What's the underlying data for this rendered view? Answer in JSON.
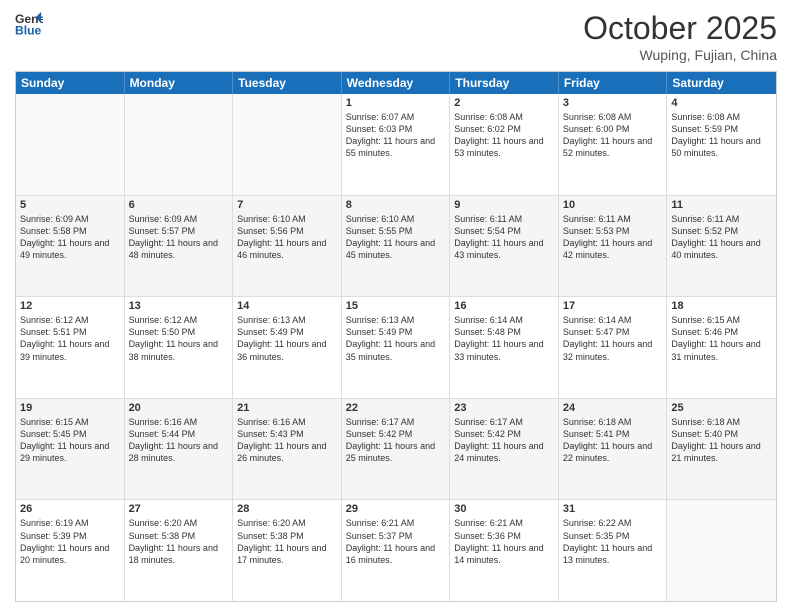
{
  "header": {
    "logo_line1": "General",
    "logo_line2": "Blue",
    "month_title": "October 2025",
    "location": "Wuping, Fujian, China"
  },
  "day_headers": [
    "Sunday",
    "Monday",
    "Tuesday",
    "Wednesday",
    "Thursday",
    "Friday",
    "Saturday"
  ],
  "weeks": [
    {
      "alt": false,
      "cells": [
        {
          "empty": true
        },
        {
          "empty": true
        },
        {
          "empty": true
        },
        {
          "day": 1,
          "sunrise": "6:07 AM",
          "sunset": "6:03 PM",
          "daylight": "11 hours and 55 minutes."
        },
        {
          "day": 2,
          "sunrise": "6:08 AM",
          "sunset": "6:02 PM",
          "daylight": "11 hours and 53 minutes."
        },
        {
          "day": 3,
          "sunrise": "6:08 AM",
          "sunset": "6:00 PM",
          "daylight": "11 hours and 52 minutes."
        },
        {
          "day": 4,
          "sunrise": "6:08 AM",
          "sunset": "5:59 PM",
          "daylight": "11 hours and 50 minutes."
        }
      ]
    },
    {
      "alt": true,
      "cells": [
        {
          "day": 5,
          "sunrise": "6:09 AM",
          "sunset": "5:58 PM",
          "daylight": "11 hours and 49 minutes."
        },
        {
          "day": 6,
          "sunrise": "6:09 AM",
          "sunset": "5:57 PM",
          "daylight": "11 hours and 48 minutes."
        },
        {
          "day": 7,
          "sunrise": "6:10 AM",
          "sunset": "5:56 PM",
          "daylight": "11 hours and 46 minutes."
        },
        {
          "day": 8,
          "sunrise": "6:10 AM",
          "sunset": "5:55 PM",
          "daylight": "11 hours and 45 minutes."
        },
        {
          "day": 9,
          "sunrise": "6:11 AM",
          "sunset": "5:54 PM",
          "daylight": "11 hours and 43 minutes."
        },
        {
          "day": 10,
          "sunrise": "6:11 AM",
          "sunset": "5:53 PM",
          "daylight": "11 hours and 42 minutes."
        },
        {
          "day": 11,
          "sunrise": "6:11 AM",
          "sunset": "5:52 PM",
          "daylight": "11 hours and 40 minutes."
        }
      ]
    },
    {
      "alt": false,
      "cells": [
        {
          "day": 12,
          "sunrise": "6:12 AM",
          "sunset": "5:51 PM",
          "daylight": "11 hours and 39 minutes."
        },
        {
          "day": 13,
          "sunrise": "6:12 AM",
          "sunset": "5:50 PM",
          "daylight": "11 hours and 38 minutes."
        },
        {
          "day": 14,
          "sunrise": "6:13 AM",
          "sunset": "5:49 PM",
          "daylight": "11 hours and 36 minutes."
        },
        {
          "day": 15,
          "sunrise": "6:13 AM",
          "sunset": "5:49 PM",
          "daylight": "11 hours and 35 minutes."
        },
        {
          "day": 16,
          "sunrise": "6:14 AM",
          "sunset": "5:48 PM",
          "daylight": "11 hours and 33 minutes."
        },
        {
          "day": 17,
          "sunrise": "6:14 AM",
          "sunset": "5:47 PM",
          "daylight": "11 hours and 32 minutes."
        },
        {
          "day": 18,
          "sunrise": "6:15 AM",
          "sunset": "5:46 PM",
          "daylight": "11 hours and 31 minutes."
        }
      ]
    },
    {
      "alt": true,
      "cells": [
        {
          "day": 19,
          "sunrise": "6:15 AM",
          "sunset": "5:45 PM",
          "daylight": "11 hours and 29 minutes."
        },
        {
          "day": 20,
          "sunrise": "6:16 AM",
          "sunset": "5:44 PM",
          "daylight": "11 hours and 28 minutes."
        },
        {
          "day": 21,
          "sunrise": "6:16 AM",
          "sunset": "5:43 PM",
          "daylight": "11 hours and 26 minutes."
        },
        {
          "day": 22,
          "sunrise": "6:17 AM",
          "sunset": "5:42 PM",
          "daylight": "11 hours and 25 minutes."
        },
        {
          "day": 23,
          "sunrise": "6:17 AM",
          "sunset": "5:42 PM",
          "daylight": "11 hours and 24 minutes."
        },
        {
          "day": 24,
          "sunrise": "6:18 AM",
          "sunset": "5:41 PM",
          "daylight": "11 hours and 22 minutes."
        },
        {
          "day": 25,
          "sunrise": "6:18 AM",
          "sunset": "5:40 PM",
          "daylight": "11 hours and 21 minutes."
        }
      ]
    },
    {
      "alt": false,
      "cells": [
        {
          "day": 26,
          "sunrise": "6:19 AM",
          "sunset": "5:39 PM",
          "daylight": "11 hours and 20 minutes."
        },
        {
          "day": 27,
          "sunrise": "6:20 AM",
          "sunset": "5:38 PM",
          "daylight": "11 hours and 18 minutes."
        },
        {
          "day": 28,
          "sunrise": "6:20 AM",
          "sunset": "5:38 PM",
          "daylight": "11 hours and 17 minutes."
        },
        {
          "day": 29,
          "sunrise": "6:21 AM",
          "sunset": "5:37 PM",
          "daylight": "11 hours and 16 minutes."
        },
        {
          "day": 30,
          "sunrise": "6:21 AM",
          "sunset": "5:36 PM",
          "daylight": "11 hours and 14 minutes."
        },
        {
          "day": 31,
          "sunrise": "6:22 AM",
          "sunset": "5:35 PM",
          "daylight": "11 hours and 13 minutes."
        },
        {
          "empty": true
        }
      ]
    }
  ]
}
